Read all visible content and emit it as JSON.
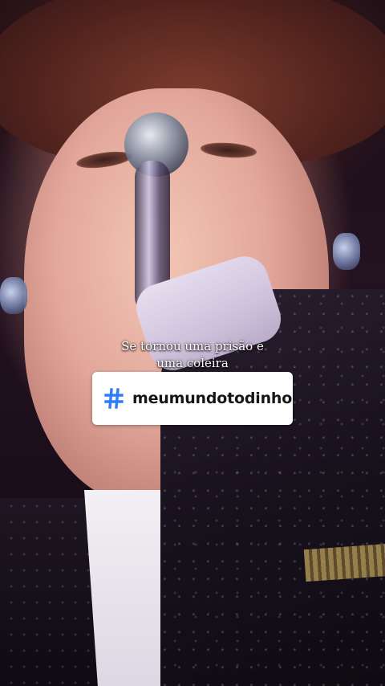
{
  "caption": {
    "line1": "Se tornou uma prisão e",
    "line2": "uma coleira"
  },
  "hashtag": {
    "icon": "hashtag-icon",
    "text": "meumundotodinho",
    "icon_color": "#2f7cf6"
  }
}
